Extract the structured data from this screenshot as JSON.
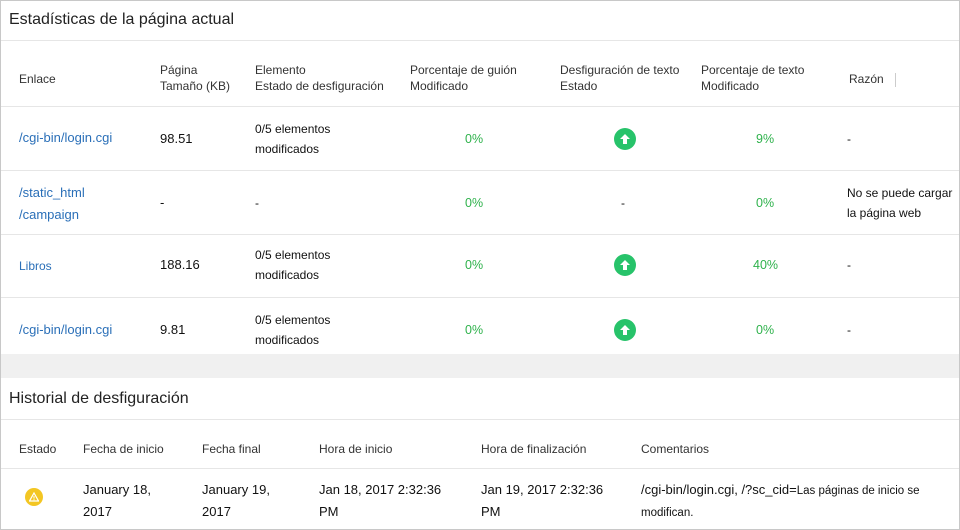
{
  "stats": {
    "title": "Estadísticas de la página actual",
    "headers": {
      "link": "Enlace",
      "size_l1": "Página",
      "size_l2": "Tamaño (KB)",
      "element_l1": "Elemento",
      "element_l2": "Estado de desfiguración",
      "script_l1": "Porcentaje de guión",
      "script_l2": "Modificado",
      "text_state_l1": "Desfiguración de texto",
      "text_state_l2": "Estado",
      "text_pct_l1": "Porcentaje de texto",
      "text_pct_l2": "Modificado",
      "reason": "Razón"
    },
    "rows": [
      {
        "link_l1": "/cgi-bin/login.cgi",
        "link_l2": "",
        "size": "98.51",
        "element_l1": "0/5 elementos",
        "element_l2": "modificados",
        "script": "0%",
        "text_state": "",
        "text_state_icon": "arrow-up-icon",
        "text_pct": "9%",
        "reason_l1": "-",
        "reason_l2": ""
      },
      {
        "link_l1": "/static_html",
        "link_l2": "/campaign",
        "size": "-",
        "element_l1": "-",
        "element_l2": "",
        "script": "0%",
        "text_state": "-",
        "text_state_icon": "",
        "text_pct": "0%",
        "reason_l1": "No se puede cargar",
        "reason_l2": "la página web"
      },
      {
        "link_l1": "Libros",
        "link_l2": "",
        "size": "188.16",
        "element_l1": "0/5 elementos",
        "element_l2": "modificados",
        "script": "0%",
        "text_state": "",
        "text_state_icon": "arrow-up-icon",
        "text_pct": "40%",
        "reason_l1": "-",
        "reason_l2": ""
      },
      {
        "link_l1": "/cgi-bin/login.cgi",
        "link_l2": "",
        "size": "9.81",
        "element_l1": "0/5 elementos",
        "element_l2": "modificados",
        "script": "0%",
        "text_state": "",
        "text_state_icon": "arrow-up-icon",
        "text_pct": "0%",
        "reason_l1": "-",
        "reason_l2": ""
      }
    ]
  },
  "history": {
    "title": "Historial de desfiguración",
    "headers": {
      "status": "Estado",
      "start_date": "Fecha de inicio",
      "end_date": "Fecha final",
      "start_time": "Hora de inicio",
      "end_time": "Hora de finalización",
      "comments": "Comentarios"
    },
    "row": {
      "status_icon": "warning-icon",
      "start_date_l1": "January 18,",
      "start_date_l2": "2017",
      "end_date_l1": "January 19,",
      "end_date_l2": "2017",
      "start_time_l1": "Jan 18, 2017 2:32:36",
      "start_time_l2": "PM",
      "end_time_l1": "Jan 19, 2017 2:32:36",
      "end_time_l2": "PM",
      "comments_l1a": "/cgi-bin/login.cgi, /?sc_cid=",
      "comments_l1b": "Las páginas de inicio se",
      "comments_l2": "modifican."
    }
  },
  "colors": {
    "link": "#2a6fb8",
    "green": "#2fb24c",
    "up_icon": "#27c36a",
    "warning": "#f3c623"
  }
}
